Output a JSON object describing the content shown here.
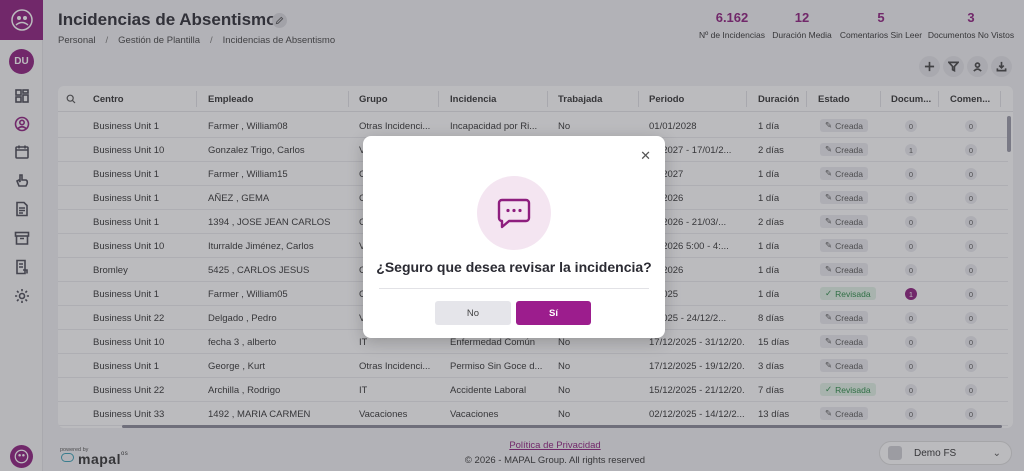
{
  "header": {
    "title": "Incidencias de Absentismo",
    "breadcrumb": [
      "Personal",
      "Gestión de Plantilla",
      "Incidencias de Absentismo"
    ]
  },
  "sidebar": {
    "avatar": "DU",
    "items": [
      "grid",
      "user",
      "calendar",
      "hand",
      "document",
      "archive",
      "report",
      "settings"
    ]
  },
  "stats": [
    {
      "value": "6.162",
      "label": "Nº de Incidencias"
    },
    {
      "value": "12",
      "label": "Duración Media"
    },
    {
      "value": "5",
      "label": "Comentarios Sin Leer"
    },
    {
      "value": "3",
      "label": "Documentos No Vistos"
    }
  ],
  "table": {
    "headers": [
      "Centro",
      "Empleado",
      "Grupo",
      "Incidencia",
      "Trabajada",
      "Periodo",
      "Duración",
      "Estado",
      "Docum...",
      "Comen..."
    ],
    "rows": [
      [
        "Business Unit 1",
        "Farmer , William08",
        "Otras Incidenci...",
        "Incapacidad por Ri...",
        "No",
        "01/01/2028",
        "1 día",
        "Creada",
        "0",
        "0"
      ],
      [
        "Business Unit 10",
        "Gonzalez Trigo, Carlos",
        "V",
        "",
        "",
        "01/2027 - 17/01/2...",
        "2 días",
        "Creada",
        "1",
        "0"
      ],
      [
        "Business Unit 1",
        "Farmer , William15",
        "C",
        "",
        "",
        "01/2027",
        "1 día",
        "Creada",
        "0",
        "0"
      ],
      [
        "Business Unit 1",
        "AÑEZ , GEMA",
        "C",
        "",
        "",
        "03/2026",
        "1 día",
        "Creada",
        "0",
        "0"
      ],
      [
        "Business Unit 1",
        "1394 , JOSE JEAN CARLOS",
        "C",
        "",
        "",
        "03/2026 - 21/03/...",
        "2 días",
        "Creada",
        "0",
        "0"
      ],
      [
        "Business Unit 10",
        "Iturralde Jiménez, Carlos",
        "V",
        "",
        "",
        "02/2026 5:00 - 4:...",
        "1 día",
        "Creada",
        "0",
        "0"
      ],
      [
        "Bromley",
        "5425 , CARLOS JESUS",
        "C",
        "",
        "",
        "01/2026",
        "1 día",
        "Creada",
        "0",
        "0"
      ],
      [
        "Business Unit 1",
        "Farmer , William05",
        "C",
        "",
        "",
        "2/2025",
        "1 día",
        "Revisada",
        "1",
        "0"
      ],
      [
        "Business Unit 22",
        "Delgado , Pedro",
        "V",
        "",
        "",
        "2/2025 - 24/12/2...",
        "8 días",
        "Creada",
        "0",
        "0"
      ],
      [
        "Business Unit 10",
        "fecha 3 , alberto",
        "IT",
        "Enfermedad Común",
        "No",
        "17/12/2025 - 31/12/20...",
        "15 días",
        "Creada",
        "0",
        "0"
      ],
      [
        "Business Unit 1",
        "George , Kurt",
        "Otras Incidenci...",
        "Permiso Sin Goce d...",
        "No",
        "17/12/2025 - 19/12/20...",
        "3 días",
        "Creada",
        "0",
        "0"
      ],
      [
        "Business Unit 22",
        "Archilla , Rodrigo",
        "IT",
        "Accidente Laboral",
        "No",
        "15/12/2025 - 21/12/20...",
        "7 días",
        "Revisada",
        "0",
        "0"
      ],
      [
        "Business Unit 33",
        "1492 , MARIA CARMEN",
        "Vacaciones",
        "Vacaciones",
        "No",
        "02/12/2025 - 14/12/2...",
        "13 días",
        "Creada",
        "0",
        "0"
      ]
    ]
  },
  "footer": {
    "privacy": "Política de Privacidad",
    "copyright": "© 2026 - MAPAL Group. All rights reserved",
    "powered": "powered by",
    "brand": "mapal",
    "brand_suffix": "os",
    "env": "Demo FS"
  },
  "modal": {
    "question": "¿Seguro que desea revisar la incidencia?",
    "no": "No",
    "yes": "Sí"
  },
  "colors": {
    "accent": "#8e1e7e",
    "revisada": "#2a8a46"
  }
}
